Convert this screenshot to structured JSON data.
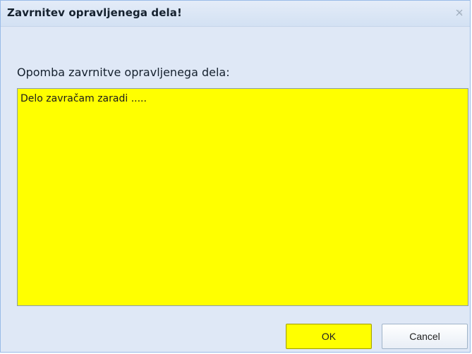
{
  "dialog": {
    "title": "Zavrnitev opravljenega dela!",
    "close_icon": "close-icon",
    "note_label": "Opomba zavrnitve opravljenega dela:",
    "note_value": "Delo zavračam zaradi .....",
    "ok_label": "OK",
    "cancel_label": "Cancel"
  },
  "colors": {
    "highlight": "#ffff00",
    "dialog_background": "#dfe8f6",
    "border": "#99bbe8"
  }
}
